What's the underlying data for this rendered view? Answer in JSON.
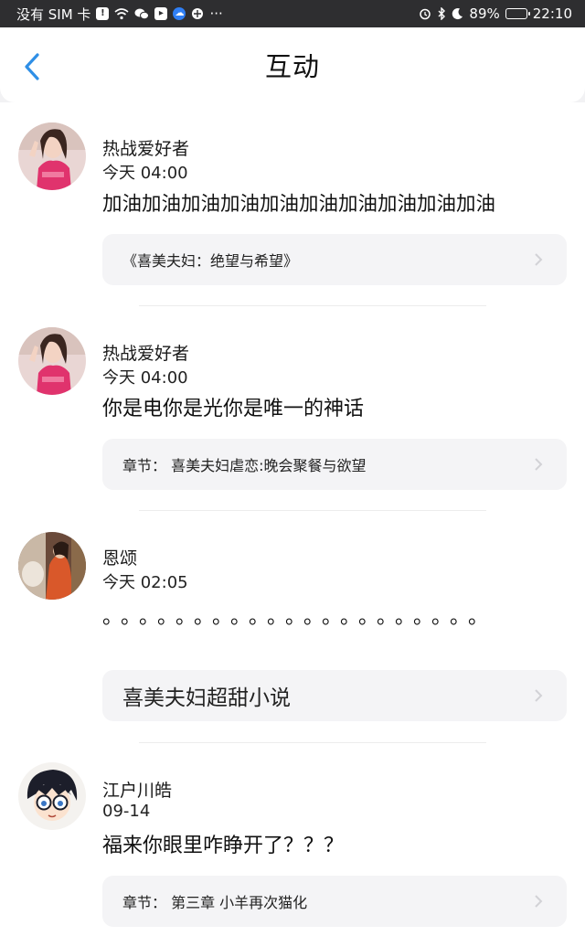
{
  "status_bar": {
    "carrier": "没有 SIM 卡",
    "more": "···",
    "battery": "89%",
    "battery_level": 0.89,
    "time": "22:10"
  },
  "header": {
    "title": "互动",
    "back_icon": "chevron-left-icon"
  },
  "colors": {
    "accent": "#2f8fe6",
    "card_bg": "#f4f4f6",
    "page_bg": "#ffffff"
  },
  "feed": [
    {
      "user": "热战爱好者",
      "time": "今天 04:00",
      "content": "加油加油加油加油加油加油加油加油加油加油",
      "ref": "《喜美夫妇：绝望与希望》"
    },
    {
      "user": "热战爱好者",
      "time": "今天 04:00",
      "content": "你是电你是光你是唯一的神话",
      "ref": "章节：  喜美夫妇虐恋:晚会聚餐与欲望"
    },
    {
      "user": "恩颂",
      "time": "今天 02:05",
      "content": "。。。。。。。。。。。。。。。。。。。。。",
      "ref": "喜美夫妇超甜小说"
    },
    {
      "user": "江户川皓",
      "time": "09-14",
      "content": "福来你眼里咋睁开了？？？",
      "ref": "章节：  第三章 小羊再次猫化"
    }
  ]
}
